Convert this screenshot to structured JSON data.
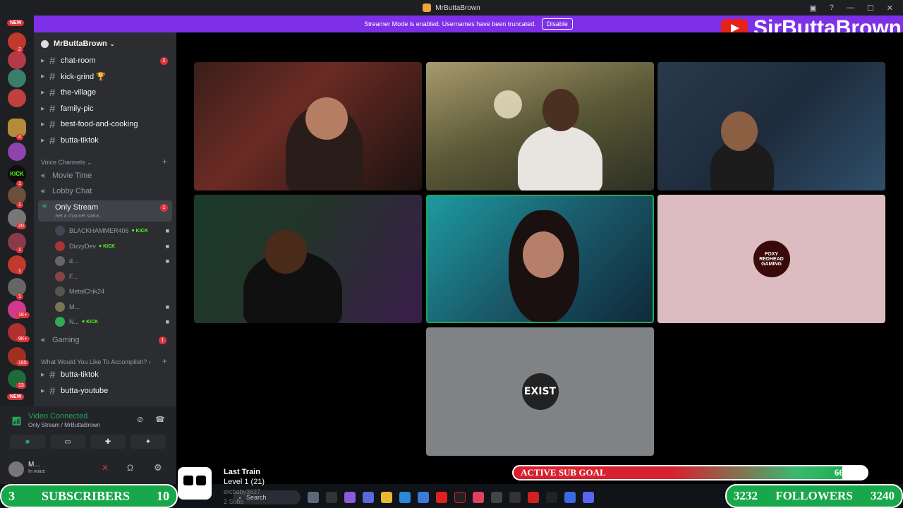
{
  "window": {
    "title": "MrButtaBrown"
  },
  "banner": {
    "text": "Streamer Mode is enabled. Usernames have been truncated.",
    "button": "Disable"
  },
  "youtube_overlay": {
    "name": "SirButtaBrown"
  },
  "server": {
    "name": "MrButtaBrown"
  },
  "channels": [
    {
      "name": "chat-room",
      "badge": "2"
    },
    {
      "name": "kick-grind 🏆",
      "badge": ""
    },
    {
      "name": "the-village",
      "badge": ""
    },
    {
      "name": "family-pic",
      "badge": ""
    },
    {
      "name": "best-food-and-cooking",
      "badge": ""
    },
    {
      "name": "butta-tiktok",
      "badge": ""
    }
  ],
  "voice_category": "Voice Channels",
  "voice_channels": [
    {
      "name": "Movie Time"
    },
    {
      "name": "Lobby Chat"
    }
  ],
  "active_voice": {
    "name": "Only Stream",
    "status": "Set a channel status",
    "badge": "1"
  },
  "voice_users": [
    {
      "name": "BLACKHAMMER406",
      "kick": "KICK"
    },
    {
      "name": "DizzyDev",
      "kick": "KICK"
    },
    {
      "name": "d...",
      "kick": ""
    },
    {
      "name": "F...",
      "kick": ""
    },
    {
      "name": "MetalChik24",
      "kick": ""
    },
    {
      "name": "M...",
      "kick": ""
    },
    {
      "name": "N...",
      "kick": "KICK"
    }
  ],
  "gaming": {
    "name": "Gaming",
    "badge": "1"
  },
  "category2": "What Would You Like To Accomplish?",
  "channels2": [
    {
      "name": "butta-tiktok"
    },
    {
      "name": "butta-youtube"
    }
  ],
  "voice_connection": {
    "status": "Video Connected",
    "location": "Only Stream / MrButtaBrown"
  },
  "user_panel": {
    "name": "M...",
    "status": "In voice"
  },
  "tiles": [
    {
      "label": "cam-1"
    },
    {
      "label": "cam-2"
    },
    {
      "label": "cam-3"
    },
    {
      "label": "cam-4"
    },
    {
      "label": "cam-5"
    },
    {
      "label": "FOXY REDHEAD GAMING"
    },
    {
      "label": "EXIST"
    }
  ],
  "subscribers": {
    "left": "3",
    "label": "SUBSCRIBERS",
    "right": "10"
  },
  "followers": {
    "left": "3232",
    "label": "FOLLOWERS",
    "right": "3240"
  },
  "sub_goal": {
    "label": "ACTIVE SUB GOAL",
    "value": "66 / 71",
    "fraction": 0.93
  },
  "train": {
    "title": "Last Train",
    "level": "Level 1  (21)",
    "user": "ercbaby3627",
    "subs": "2 Subs"
  },
  "taskbar": {
    "search": "Search"
  },
  "rail": {
    "new_top": "NEW",
    "new_bottom": "NEW",
    "badges": [
      "2",
      "4",
      "1",
      "1",
      "20",
      "1",
      "1",
      "1",
      "1K+",
      "9K+",
      "165",
      "13"
    ]
  },
  "colors": {
    "banner": "#7d30e8",
    "discord_green": "#23a55a",
    "overlay_green": "#18a84b",
    "kick_green": "#53fc18"
  }
}
